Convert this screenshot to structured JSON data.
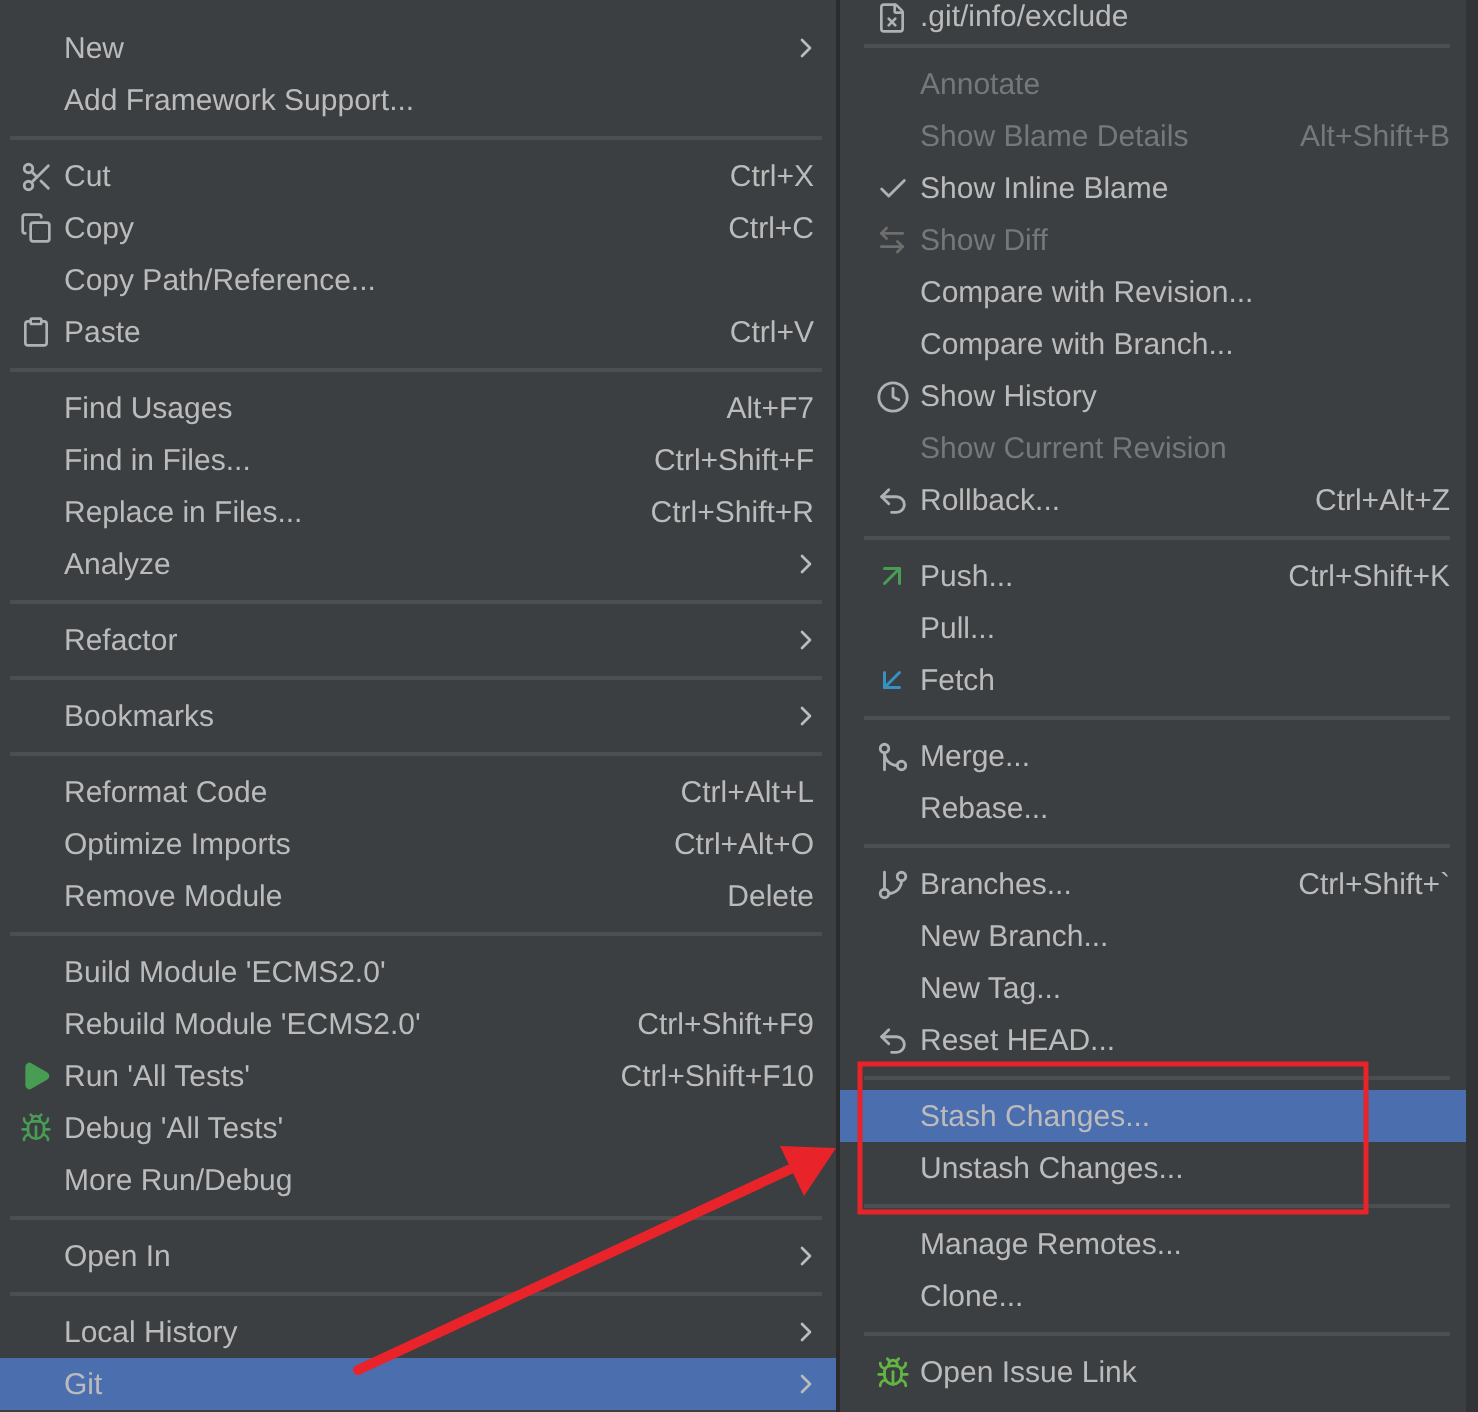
{
  "context_menu": {
    "sections": [
      {
        "items": [
          {
            "label": "New",
            "submenu": true,
            "selected": false
          },
          {
            "label": "Add Framework Support...",
            "submenu": false,
            "selected": false
          }
        ]
      },
      {
        "items": [
          {
            "label": "Cut",
            "shortcut": "Ctrl+X",
            "submenu": false,
            "selected": false
          },
          {
            "label": "Copy",
            "shortcut": "Ctrl+C",
            "submenu": false,
            "selected": false
          },
          {
            "label": "Copy Path/Reference...",
            "submenu": false,
            "selected": false
          },
          {
            "label": "Paste",
            "shortcut": "Ctrl+V",
            "submenu": false,
            "selected": false
          }
        ]
      },
      {
        "items": [
          {
            "label": "Find Usages",
            "shortcut": "Alt+F7",
            "submenu": false,
            "selected": false
          },
          {
            "label": "Find in Files...",
            "shortcut": "Ctrl+Shift+F",
            "submenu": false,
            "selected": false
          },
          {
            "label": "Replace in Files...",
            "shortcut": "Ctrl+Shift+R",
            "submenu": false,
            "selected": false
          },
          {
            "label": "Analyze",
            "submenu": true,
            "selected": false
          }
        ]
      },
      {
        "items": [
          {
            "label": "Refactor",
            "submenu": true,
            "selected": false
          }
        ]
      },
      {
        "items": [
          {
            "label": "Bookmarks",
            "submenu": true,
            "selected": false
          }
        ]
      },
      {
        "items": [
          {
            "label": "Reformat Code",
            "shortcut": "Ctrl+Alt+L",
            "submenu": false,
            "selected": false
          },
          {
            "label": "Optimize Imports",
            "shortcut": "Ctrl+Alt+O",
            "submenu": false,
            "selected": false
          },
          {
            "label": "Remove Module",
            "shortcut": "Delete",
            "submenu": false,
            "selected": false
          }
        ]
      },
      {
        "items": [
          {
            "label": "Build Module 'ECMS2.0'",
            "submenu": false,
            "selected": false
          },
          {
            "label": "Rebuild Module 'ECMS2.0'",
            "shortcut": "Ctrl+Shift+F9",
            "submenu": false,
            "selected": false
          },
          {
            "label": "Run 'All Tests'",
            "shortcut": "Ctrl+Shift+F10",
            "submenu": false,
            "selected": false
          },
          {
            "label": "Debug 'All Tests'",
            "submenu": false,
            "selected": false
          },
          {
            "label": "More Run/Debug",
            "submenu": false,
            "selected": false
          }
        ]
      },
      {
        "items": [
          {
            "label": "Open In",
            "submenu": true,
            "selected": false
          }
        ]
      },
      {
        "items": [
          {
            "label": "Local History",
            "submenu": true,
            "selected": false
          },
          {
            "label": "Git",
            "submenu": true,
            "selected": true
          }
        ]
      }
    ]
  },
  "git_submenu": {
    "sections": [
      {
        "items": [
          {
            "label": ".git/info/exclude",
            "selected": false
          }
        ]
      },
      {
        "items": [
          {
            "label": "Annotate",
            "disabled": true,
            "checked": false,
            "selected": false
          },
          {
            "label": "Show Blame Details",
            "shortcut": "Alt+Shift+B",
            "disabled": true,
            "checked": false,
            "selected": false
          },
          {
            "label": "Show Inline Blame",
            "disabled": false,
            "checked": true,
            "selected": false
          },
          {
            "label": "Show Diff",
            "disabled": true,
            "checked": false,
            "selected": false
          },
          {
            "label": "Compare with Revision...",
            "disabled": false,
            "checked": false,
            "selected": false
          },
          {
            "label": "Compare with Branch...",
            "disabled": false,
            "checked": false,
            "selected": false
          },
          {
            "label": "Show History",
            "disabled": false,
            "checked": false,
            "selected": false
          },
          {
            "label": "Show Current Revision",
            "disabled": true,
            "checked": false,
            "selected": false
          },
          {
            "label": "Rollback...",
            "shortcut": "Ctrl+Alt+Z",
            "disabled": false,
            "checked": false,
            "selected": false
          }
        ]
      },
      {
        "items": [
          {
            "label": "Push...",
            "shortcut": "Ctrl+Shift+K",
            "selected": false
          },
          {
            "label": "Pull...",
            "selected": false
          },
          {
            "label": "Fetch",
            "selected": false
          }
        ]
      },
      {
        "items": [
          {
            "label": "Merge...",
            "selected": false
          },
          {
            "label": "Rebase...",
            "selected": false
          }
        ]
      },
      {
        "items": [
          {
            "label": "Branches...",
            "shortcut": "Ctrl+Shift+`",
            "selected": false
          },
          {
            "label": "New Branch...",
            "selected": false
          },
          {
            "label": "New Tag...",
            "selected": false
          },
          {
            "label": "Reset HEAD...",
            "selected": false
          }
        ]
      },
      {
        "items": [
          {
            "label": "Stash Changes...",
            "selected": true
          },
          {
            "label": "Unstash Changes...",
            "selected": false
          }
        ]
      },
      {
        "items": [
          {
            "label": "Manage Remotes...",
            "selected": false
          },
          {
            "label": "Clone...",
            "selected": false
          }
        ]
      },
      {
        "items": [
          {
            "label": "Open Issue Link",
            "selected": false
          }
        ]
      }
    ]
  }
}
